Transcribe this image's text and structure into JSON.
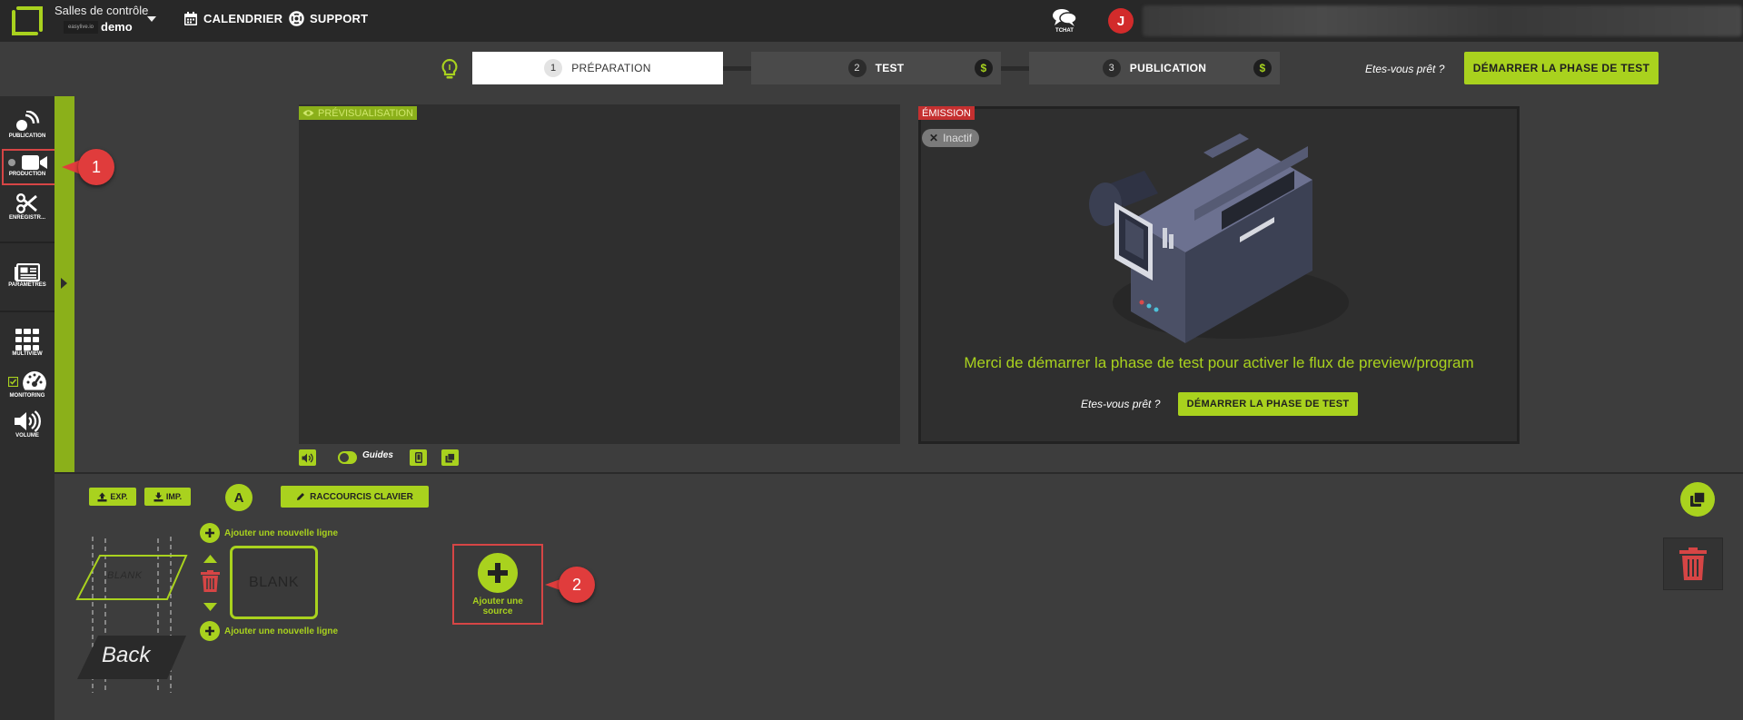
{
  "topbar": {
    "org_title": "Salles de contrôle",
    "org_badge": "easylive.io",
    "org_name": "demo",
    "nav": [
      {
        "label": "CALENDRIER",
        "icon": "calendar-icon"
      },
      {
        "label": "SUPPORT",
        "icon": "lifebuoy-icon"
      }
    ],
    "tchat_label": "TCHAT",
    "avatar_initial": "J"
  },
  "steps": [
    {
      "num": "1",
      "label": "PRÉPARATION",
      "state": "active"
    },
    {
      "num": "2",
      "label": "TEST",
      "state": "inactive",
      "badge": "$"
    },
    {
      "num": "3",
      "label": "PUBLICATION",
      "state": "inactive",
      "badge": "$"
    }
  ],
  "header": {
    "ready_text": "Etes-vous prêt ?",
    "start_test_label": "DÉMARRER LA PHASE DE TEST"
  },
  "sidebar": {
    "items": [
      {
        "label": "PUBLICATION",
        "icon": "broadcast-icon"
      },
      {
        "label": "PRODUCTION",
        "icon": "video-camera-icon"
      },
      {
        "label": "ENREGISTR...",
        "icon": "scissors-icon"
      },
      {
        "label": "PARAMÈTRES",
        "icon": "newspaper-icon"
      },
      {
        "label": "MULTIVIEW",
        "icon": "grid-icon"
      },
      {
        "label": "MONITORING",
        "icon": "gauge-icon"
      },
      {
        "label": "VOLUME",
        "icon": "speaker-icon"
      }
    ]
  },
  "callouts": [
    "1",
    "2"
  ],
  "preview": {
    "tag": "PRÉVISUALISATION",
    "guides_label": "Guides"
  },
  "emission": {
    "tag": "ÉMISSION",
    "status": "Inactif",
    "message": "Merci de démarrer la phase de test pour activer le flux de preview/program",
    "ready_text": "Etes-vous prêt ?",
    "start_label": "DÉMARRER LA PHASE DE TEST"
  },
  "toolbar": {
    "exp_label": "EXP.",
    "imp_label": "IMP.",
    "a_label": "A",
    "shortcuts_label": "RACCOURCIS CLAVIER"
  },
  "layers": {
    "add_line_label": "Ajouter une nouvelle ligne",
    "blank_label": "BLANK",
    "back_label": "Back",
    "card_label": "BLANK"
  },
  "add_source": {
    "line1": "Ajouter une",
    "line2": "source"
  },
  "colors": {
    "accent": "#a9d21e",
    "danger": "#d64545",
    "avatar": "#d22b2b"
  }
}
